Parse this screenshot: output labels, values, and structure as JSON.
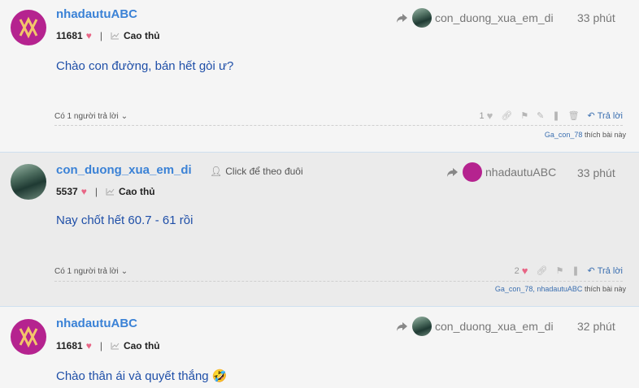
{
  "posts": [
    {
      "username": "nhadautuABC",
      "points": "11681",
      "rank": "Cao thủ",
      "reply_to_user": "con_duong_xua_em_di",
      "time": "33 phút",
      "content": "Chào con đường, bán hết gòi ư?",
      "replies_label": "Có 1 người trả lời",
      "like_count": "1",
      "reply_button": "Trả lời",
      "liked_by": "Ga_con_78",
      "liked_suffix": "thích bài này"
    },
    {
      "username": "con_duong_xua_em_di",
      "follow_label": "Click để theo đuôi",
      "points": "5537",
      "rank": "Cao thủ",
      "reply_to_user": "nhadautuABC",
      "time": "33 phút",
      "content": "Nay chốt hết 60.7 - 61 rồi",
      "replies_label": "Có 1 người trả lời",
      "like_count": "2",
      "reply_button": "Trả lời",
      "liked_by": "Ga_con_78, nhadautuABC",
      "liked_suffix": "thích bài này"
    },
    {
      "username": "nhadautuABC",
      "points": "11681",
      "rank": "Cao thủ",
      "reply_to_user": "con_duong_xua_em_di",
      "time": "32 phút",
      "content": "Chào thân ái và quyết thắng",
      "emoji": "🤣"
    }
  ],
  "colors": {
    "username": "#3b82d6",
    "content": "#1f4fa8",
    "heart": "#e86585",
    "avatar_brand": "#b5238f",
    "alt_row": "#ebebeb"
  }
}
